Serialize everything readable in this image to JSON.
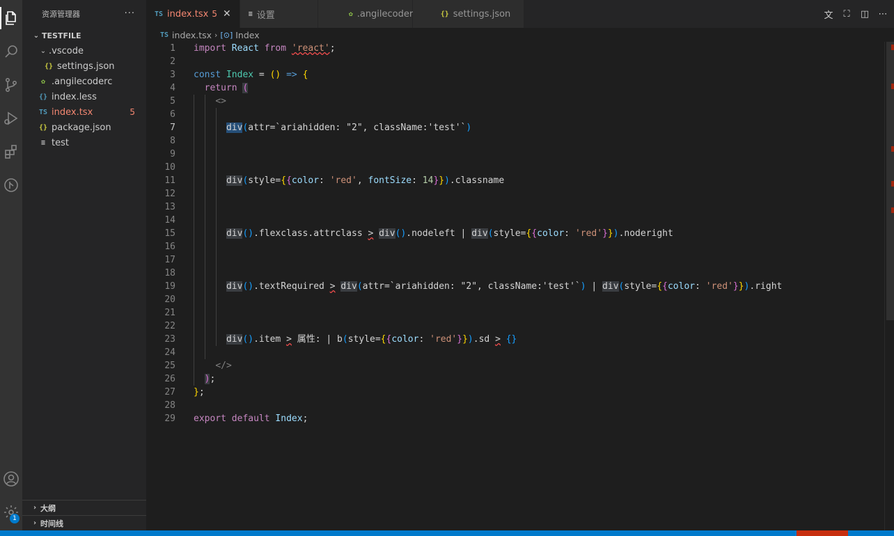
{
  "sidebar": {
    "title": "资源管理器",
    "more": "···",
    "root": "TESTFILE",
    "items": [
      {
        "name": ".vscode",
        "icon": "folder",
        "chev": "⌄",
        "color": "#cccccc"
      },
      {
        "name": "settings.json",
        "icon": "{}",
        "color": "#cccccc",
        "icon_color": "#cbcb41"
      },
      {
        "name": ".angilecoderc",
        "icon": "angile",
        "color": "#cccccc",
        "icon_color": "#8dc149"
      },
      {
        "name": "index.less",
        "icon": "{}",
        "color": "#cccccc",
        "icon_color": "#519aba"
      },
      {
        "name": "index.tsx",
        "icon": "TS",
        "color": "#f48771",
        "icon_color": "#519aba",
        "errors": "5"
      },
      {
        "name": "package.json",
        "icon": "{}",
        "color": "#cccccc",
        "icon_color": "#cbcb41"
      },
      {
        "name": "test",
        "icon": "≡",
        "color": "#cccccc",
        "icon_color": "#cccccc"
      }
    ],
    "outline": "大纲",
    "timeline": "时间线"
  },
  "activity": {
    "settings_badge": "1"
  },
  "tabs": [
    {
      "label": "index.tsx",
      "icon": "TS",
      "icon_color": "#519aba",
      "count": "5",
      "close": "✕",
      "active": true
    },
    {
      "label": "设置",
      "icon": "≡",
      "icon_color": "#cccccc"
    },
    {
      "label": ".angilecoderc",
      "icon": "✿",
      "icon_color": "#8dc149"
    },
    {
      "label": "settings.json",
      "icon": "{}",
      "icon_color": "#cbcb41"
    }
  ],
  "breadcrumb": {
    "file": "index.tsx",
    "symbol": "Index"
  },
  "editor": {
    "current_line": 7,
    "line_numbers": [
      "1",
      "2",
      "3",
      "4",
      "5",
      "6",
      "7",
      "8",
      "9",
      "10",
      "11",
      "12",
      "13",
      "14",
      "15",
      "16",
      "17",
      "18",
      "19",
      "20",
      "21",
      "22",
      "23",
      "24",
      "25",
      "26",
      "27",
      "28",
      "29"
    ]
  },
  "colors": {
    "accent": "#007acc",
    "error": "#f48771",
    "prettier": "#c72e0f"
  }
}
